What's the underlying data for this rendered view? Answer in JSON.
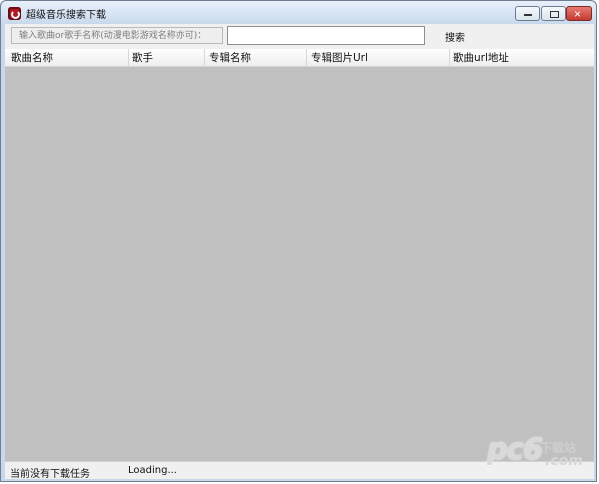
{
  "window": {
    "title": "超级音乐搜索下载",
    "controls": [
      "minimize-icon",
      "maximize-icon",
      "close-icon"
    ]
  },
  "search": {
    "prompt": "输入歌曲or歌手名称(动漫电影游戏名称亦可)：",
    "value": "",
    "placeholder": "",
    "button_label": "搜索"
  },
  "table": {
    "columns": [
      "歌曲名称",
      "歌手",
      "专辑名称",
      "专辑图片Url",
      "歌曲url地址"
    ],
    "rows": []
  },
  "status": {
    "tasks": "当前没有下载任务",
    "loading": "Loading..."
  },
  "watermark": {
    "main": "pc6",
    "sub": "下载站",
    "domain": ".com"
  }
}
